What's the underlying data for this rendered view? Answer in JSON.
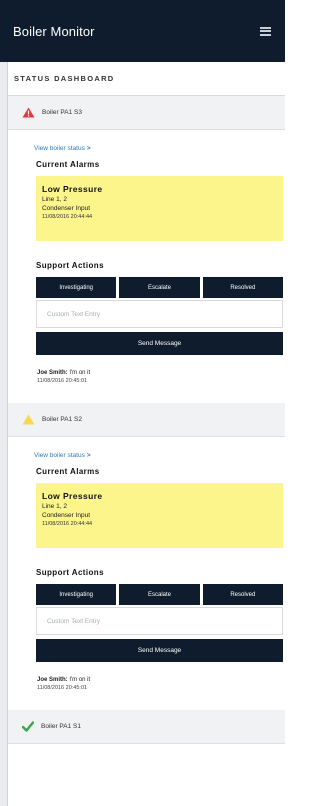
{
  "app": {
    "title": "Boiler Monitor"
  },
  "dashboard": {
    "title": "STATUS DASHBOARD"
  },
  "boilers": [
    {
      "name": "Boiler PA1 S3",
      "status_icon": "red-alert-triangle",
      "status_color": "#e03a3e",
      "link": "View boiler status",
      "link_chevron": ">",
      "alarms_title": "Current Alarms",
      "alarm": {
        "title": "Low Pressure",
        "line1": "Line 1, 2",
        "line2": "Condenser Input",
        "time": "11/08/2016 20:44:44"
      },
      "actions_title": "Support Actions",
      "actions": [
        "Investigating",
        "Escalate",
        "Resolved"
      ],
      "custom_placeholder": "Custom Text Entry",
      "send_label": "Send Message",
      "message": {
        "user": "Joe Smith:",
        "text": "I'm on it",
        "time": "11/08/2016 20:45:01"
      }
    },
    {
      "name": "Boiler PA1 S2",
      "status_icon": "yellow-warning-triangle",
      "status_color": "#f5d94e",
      "link": "View boiler status",
      "link_chevron": ">",
      "alarms_title": "Current Alarms",
      "alarm": {
        "title": "Low Pressure",
        "line1": "Line 1, 2",
        "line2": "Condenser Input",
        "time": "11/08/2016 20:44:44"
      },
      "actions_title": "Support Actions",
      "actions": [
        "Investigating",
        "Escalate",
        "Resolved"
      ],
      "custom_placeholder": "Custom Text Entry",
      "send_label": "Send Message",
      "message": {
        "user": "Joe Smith:",
        "text": "I'm on it",
        "time": "11/08/2016 20:45:01"
      }
    },
    {
      "name": "Boiler PA1 S1",
      "status_icon": "green-checkmark",
      "status_color": "#3aa54a"
    }
  ],
  "colors": {
    "header_bg": "#0e1c2e",
    "alarm_bg": "#fbf58c",
    "link": "#2f7ab8"
  }
}
